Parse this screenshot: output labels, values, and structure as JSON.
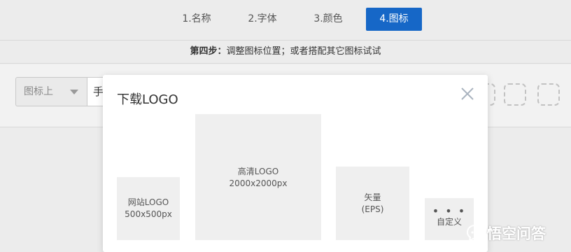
{
  "steps": [
    {
      "label": "1.名称",
      "active": false
    },
    {
      "label": "2.字体",
      "active": false
    },
    {
      "label": "3.颜色",
      "active": false
    },
    {
      "label": "4.图标",
      "active": true
    }
  ],
  "hint": {
    "strong": "第四步：",
    "text": "调整图标位置；或者搭配其它图标试试"
  },
  "toolbar": {
    "position_select_value": "图标上",
    "text_input_value": "手"
  },
  "modal": {
    "title": "下载LOGO",
    "options": {
      "website": {
        "name": "网站LOGO",
        "size": "500x500px"
      },
      "hd": {
        "name": "高清LOGO",
        "size": "2000x2000px"
      },
      "vector": {
        "name": "矢量",
        "size": "(EPS)"
      },
      "custom": {
        "dots": "• • •",
        "name": "自定义"
      }
    }
  },
  "watermark": {
    "text": "悟空问答"
  },
  "colors": {
    "accent": "#1667c7"
  }
}
